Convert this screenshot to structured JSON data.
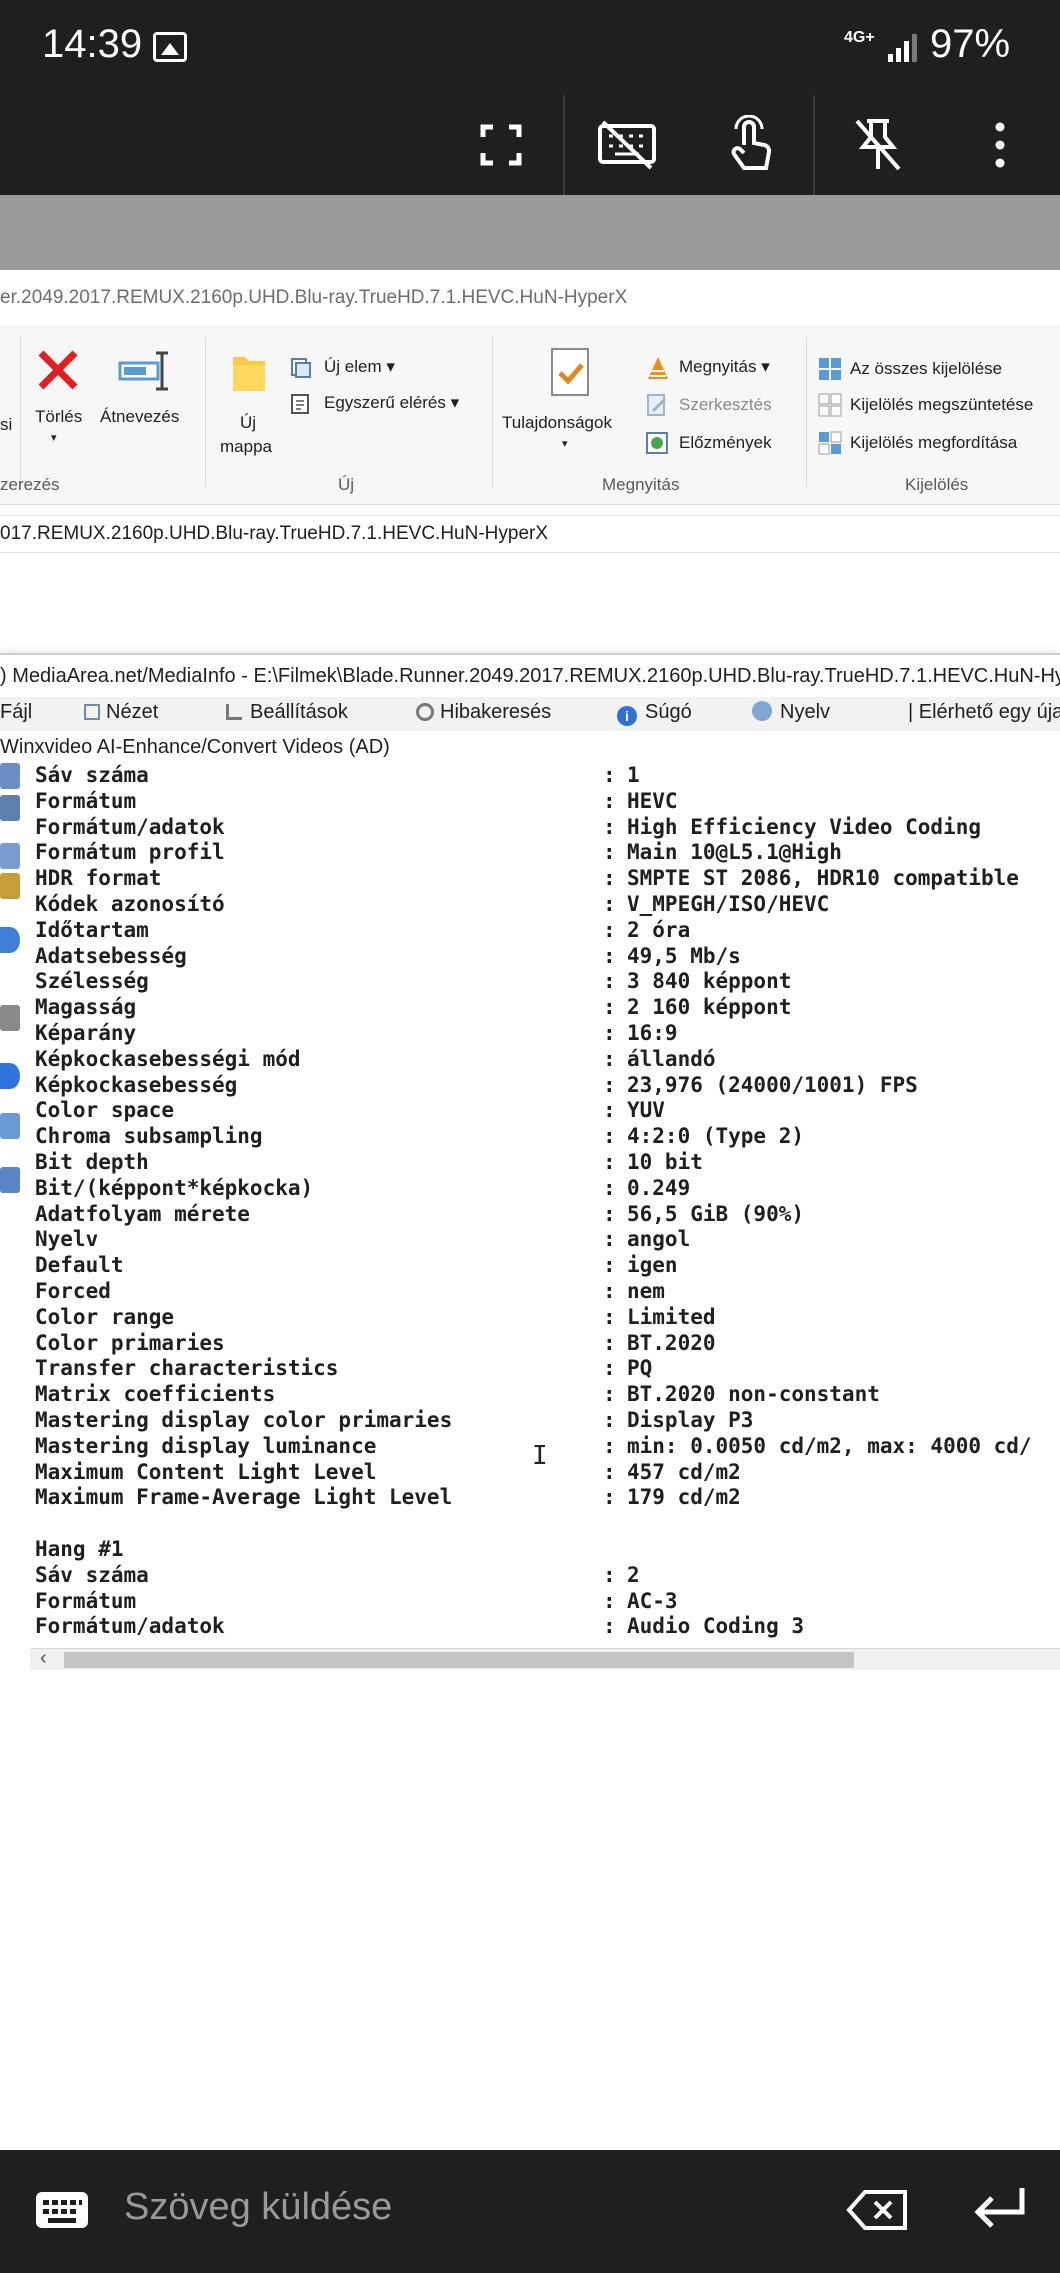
{
  "status": {
    "time": "14:39",
    "network": "4G+",
    "battery": "97%"
  },
  "toolbar": {
    "fullscreen": "fullscreen-icon",
    "keyboard_off": "keyboard-off-icon",
    "touch": "touch-icon",
    "pin_off": "pin-off-icon",
    "more": "more-vert-icon"
  },
  "explorer": {
    "title": "er.2049.2017.REMUX.2160p.UHD.Blu-ray.TrueHD.7.1.HEVC.HuN-HyperX",
    "ribbon": {
      "si": "si",
      "torles": "Törlés",
      "atnevezes": "Átnevezés",
      "uj_mappa_1": "Új",
      "uj_mappa_2": "mappa",
      "uj_elem": "Új elem ▾",
      "egyszeru_eleres": "Egyszerű elérés ▾",
      "tulajdonsagok": "Tulajdonságok",
      "megnyitas": "Megnyitás ▾",
      "szerkesztes": "Szerkesztés",
      "elozmenyek": "Előzmények",
      "osszes_kijelolese": "Az összes kijelölése",
      "kijeloles_megszuntetese": "Kijelölés megszüntetése",
      "kijeloles_megforditasa": "Kijelölés megfordítása",
      "grp_rendezes": "zerezés",
      "grp_uj": "Új",
      "grp_megnyitas": "Megnyitás",
      "grp_kijeloles": "Kijelölés"
    },
    "address": "017.REMUX.2160p.UHD.Blu-ray.TrueHD.7.1.HEVC.HuN-HyperX"
  },
  "mediainfo": {
    "title": ") MediaArea.net/MediaInfo - E:\\Filmek\\Blade.Runner.2049.2017.REMUX.2160p.UHD.Blu-ray.TrueHD.7.1.HEVC.HuN-Hy",
    "menu": {
      "fajl": "Fájl",
      "nezet": "Nézet",
      "beallitasok": "Beállítások",
      "hibakereses": "Hibakeresés",
      "sugo": "Súgó",
      "nyelv": "Nyelv",
      "elerheto": "| Elérhető egy újab"
    },
    "adline": "Winxvideo AI-Enhance/Convert Videos (AD)",
    "rows": [
      {
        "k": "Sáv száma",
        "c": ":",
        "v": "1"
      },
      {
        "k": "Formátum",
        "c": ":",
        "v": "HEVC"
      },
      {
        "k": "Formátum/adatok",
        "c": ":",
        "v": "High Efficiency Video Coding"
      },
      {
        "k": "Formátum profil",
        "c": ":",
        "v": "Main 10@L5.1@High"
      },
      {
        "k": "HDR format",
        "c": ":",
        "v": "SMPTE ST 2086, HDR10 compatible"
      },
      {
        "k": "Kódek azonosító",
        "c": ":",
        "v": "V_MPEGH/ISO/HEVC"
      },
      {
        "k": "Időtartam",
        "c": ":",
        "v": "2 óra"
      },
      {
        "k": "Adatsebesség",
        "c": ":",
        "v": "49,5 Mb/s"
      },
      {
        "k": "Szélesség",
        "c": ":",
        "v": "3 840 képpont"
      },
      {
        "k": "Magasság",
        "c": ":",
        "v": "2 160 képpont"
      },
      {
        "k": "Képarány",
        "c": ":",
        "v": "16:9"
      },
      {
        "k": "Képkockasebességi mód",
        "c": ":",
        "v": "állandó"
      },
      {
        "k": "Képkockasebesség",
        "c": ":",
        "v": "23,976 (24000/1001) FPS"
      },
      {
        "k": "Color space",
        "c": ":",
        "v": "YUV"
      },
      {
        "k": "Chroma subsampling",
        "c": ":",
        "v": "4:2:0 (Type 2)"
      },
      {
        "k": "Bit depth",
        "c": ":",
        "v": "10 bit"
      },
      {
        "k": "Bit/(képpont*képkocka)",
        "c": ":",
        "v": "0.249"
      },
      {
        "k": "Adatfolyam mérete",
        "c": ":",
        "v": "56,5 GiB (90%)"
      },
      {
        "k": "Nyelv",
        "c": ":",
        "v": "angol"
      },
      {
        "k": "Default",
        "c": ":",
        "v": "igen"
      },
      {
        "k": "Forced",
        "c": ":",
        "v": "nem"
      },
      {
        "k": "Color range",
        "c": ":",
        "v": "Limited"
      },
      {
        "k": "Color primaries",
        "c": ":",
        "v": "BT.2020"
      },
      {
        "k": "Transfer characteristics",
        "c": ":",
        "v": "PQ"
      },
      {
        "k": "Matrix coefficients",
        "c": ":",
        "v": "BT.2020 non-constant"
      },
      {
        "k": "Mastering display color primaries",
        "c": ":",
        "v": "Display P3"
      },
      {
        "k": "Mastering display luminance",
        "c": ":",
        "v": "min: 0.0050 cd/m2, max: 4000 cd/"
      },
      {
        "k": "Maximum Content Light Level",
        "c": ":",
        "v": "457 cd/m2"
      },
      {
        "k": "Maximum Frame-Average Light Level",
        "c": ":",
        "v": "179 cd/m2"
      },
      {
        "k": "",
        "c": "",
        "v": ""
      },
      {
        "k": "Hang #1",
        "c": "",
        "v": ""
      },
      {
        "k": "Sáv száma",
        "c": ":",
        "v": "2"
      },
      {
        "k": "Formátum",
        "c": ":",
        "v": "AC-3"
      },
      {
        "k": "Formátum/adatok",
        "c": ":",
        "v": "Audio Coding 3"
      }
    ]
  },
  "inputbar": {
    "placeholder": "Szöveg küldése",
    "keyboard": "keyboard-icon",
    "backspace": "backspace-icon",
    "enter": "enter-icon"
  },
  "colors": {
    "accent": "#1f1f1f",
    "navy": "#2f3e4c",
    "gray": "#9b9b9b"
  }
}
